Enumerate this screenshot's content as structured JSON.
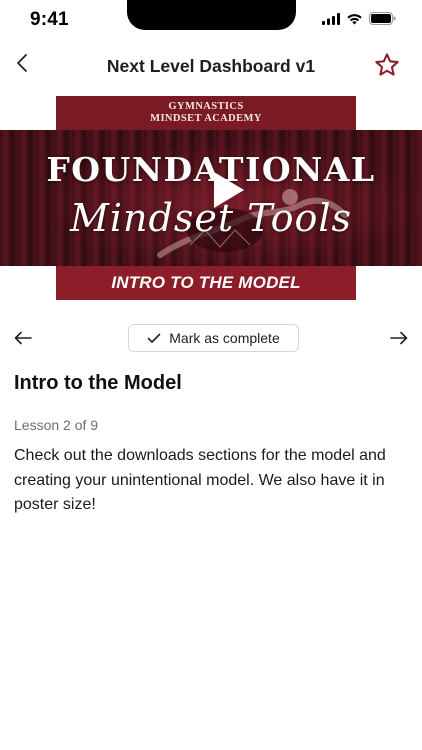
{
  "status_bar": {
    "time": "9:41",
    "icons": [
      "signal-icon",
      "wifi-icon",
      "battery-icon"
    ]
  },
  "nav": {
    "title": "Next Level Dashboard v1",
    "back_icon": "chevron-left-icon",
    "favorite_icon": "star-outline-icon"
  },
  "video": {
    "academy_line1": "GYMNASTICS",
    "academy_line2": "MINDSET ACADEMY",
    "headline": "FOUNDATIONAL",
    "script_text": "Mindset Tools",
    "banner_text": "INTRO TO THE MODEL",
    "play_icon": "play-icon"
  },
  "lesson_nav": {
    "prev_icon": "arrow-left-icon",
    "next_icon": "arrow-right-icon",
    "complete_icon": "checkmark-icon",
    "complete_label": "Mark as complete"
  },
  "lesson": {
    "title": "Intro to the Model",
    "count": "Lesson 2 of 9",
    "description": "Check out the downloads sections for the model and creating your unintentional model. We also have it in poster size!"
  },
  "colors": {
    "accent": "#7a1a22",
    "star": "#8b1e28"
  }
}
